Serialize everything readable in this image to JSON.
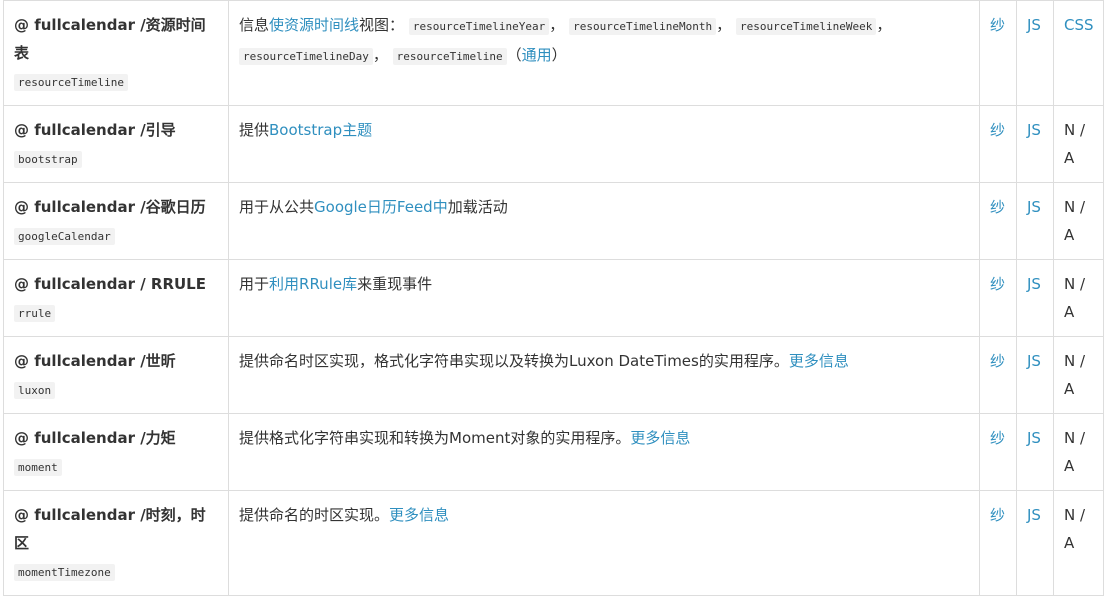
{
  "rows": [
    {
      "package": "@ fullcalendar /资源时间表",
      "code": "resourceTimeline",
      "desc_prefix": "信息",
      "desc_link": "使资源时间线",
      "desc_mid": "视图：",
      "views": [
        "resourceTimelineYear",
        "resourceTimelineMonth",
        "resourceTimelineWeek",
        "resourceTimelineDay",
        "resourceTimeline"
      ],
      "sep": "，",
      "paren_open": "（",
      "paren_link": "通用",
      "paren_close": "）",
      "col_yarn": "纱",
      "col_js": "JS",
      "col_css": "CSS"
    },
    {
      "package": "@ fullcalendar /引导",
      "code": "bootstrap",
      "desc_prefix": "提供",
      "desc_link": "Bootstrap主题",
      "col_yarn": "纱",
      "col_js": "JS",
      "col_css": "N / A"
    },
    {
      "package": "@ fullcalendar /谷歌日历",
      "code": "googleCalendar",
      "desc_prefix": "用于从公共",
      "desc_link": "Google日历Feed中",
      "desc_suffix": "加载活动",
      "col_yarn": "纱",
      "col_js": "JS",
      "col_css": "N / A"
    },
    {
      "package": "@ fullcalendar / RRULE",
      "code": "rrule",
      "desc_prefix": "用于",
      "desc_link": "利用RRule库",
      "desc_suffix": "来重现事件",
      "col_yarn": "纱",
      "col_js": "JS",
      "col_css": "N / A"
    },
    {
      "package": "@ fullcalendar /世昕",
      "code": "luxon",
      "desc_prefix": "提供命名时区实现，格式化字符串实现以及转换为Luxon DateTimes的实用程序。",
      "desc_link": "更多信息",
      "col_yarn": "纱",
      "col_js": "JS",
      "col_css": "N / A"
    },
    {
      "package": "@ fullcalendar /力矩",
      "code": "moment",
      "desc_prefix": "提供格式化字符串实现和转换为Moment对象的实用程序。",
      "desc_link": "更多信息",
      "col_yarn": "纱",
      "col_js": "JS",
      "col_css": "N / A"
    },
    {
      "package": "@ fullcalendar /时刻，时区",
      "code": "momentTimezone",
      "desc_prefix": "提供命名的时区实现。",
      "desc_link": "更多信息",
      "col_yarn": "纱",
      "col_js": "JS",
      "col_css": "N / A"
    }
  ]
}
